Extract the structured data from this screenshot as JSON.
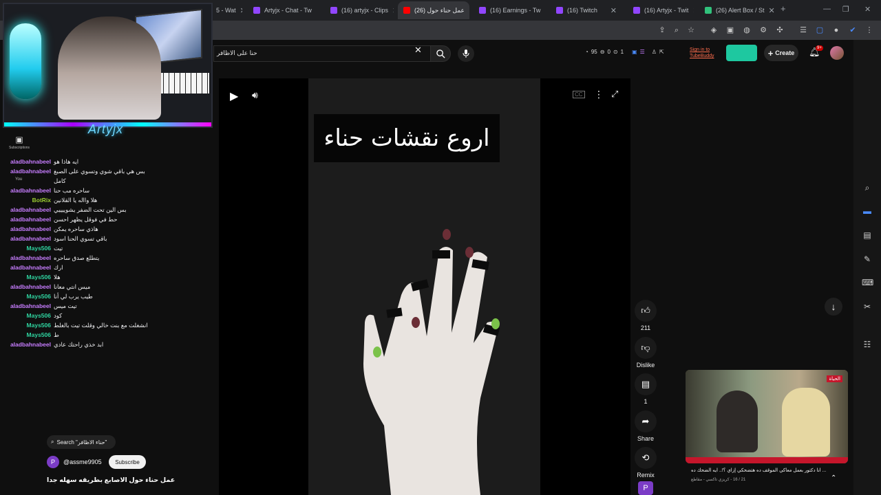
{
  "browser": {
    "tabs": [
      {
        "title": "5 - Wat",
        "favicon_color": "#9146ff"
      },
      {
        "title": "Artyjx - Chat - Tw",
        "favicon_color": "#9146ff"
      },
      {
        "title": "(16) artyjx - Clips",
        "favicon_color": "#9146ff"
      },
      {
        "title": "(26) عمل حناء حول",
        "favicon_color": "#ff0000",
        "active": true
      },
      {
        "title": "(16) Earnings - Tw",
        "favicon_color": "#9146ff"
      },
      {
        "title": "(16) Twitch",
        "favicon_color": "#9146ff"
      },
      {
        "title": "(16) Artyjx - Twit",
        "favicon_color": "#9146ff"
      },
      {
        "title": "(26) Alert Box / St",
        "favicon_color": "#31c27c"
      }
    ],
    "new_tab": "+",
    "window_controls": {
      "minimize": "—",
      "maximize": "❐",
      "close": "✕"
    }
  },
  "youtube": {
    "search_query": "حنا على الاظافر",
    "ext_stats": {
      "likes": "95",
      "dislikes": "0",
      "views": "1"
    },
    "tubebuddy": "Sign in to TubeBuddy",
    "create_label": "Create",
    "notif_badge": "9+"
  },
  "video": {
    "title_card": "اروع نقشات حناء"
  },
  "actions": {
    "like_count": "211",
    "dislike_label": "Dislike",
    "comment_count": "1",
    "share_label": "Share",
    "remix_label": "Remix"
  },
  "mini_player": {
    "logo": "الحياة",
    "caption": "... انا دكتور بعمل معاكي الموقف ده هتضحكي إزاي ؟!.. ايه الضحك ده",
    "sub": "21 / 16 - كريزي تاكسي - مقاطع"
  },
  "twitch": {
    "brand": "Artyjx",
    "subscriptions_label": "Subscriptions",
    "you_label": "You",
    "chat": [
      {
        "user": "aladbahnabeel",
        "color": "#c77dff",
        "text": "ايه هاذا هو"
      },
      {
        "user": "aladbahnabeel",
        "color": "#c77dff",
        "text": "بس هي باقي شوي وتسوي على الصبغ"
      },
      {
        "user": "",
        "color": "#c77dff",
        "text": "كامل"
      },
      {
        "user": "aladbahnabeel",
        "color": "#c77dff",
        "text": "ساحره مب حنا"
      },
      {
        "user": "BotRix",
        "color": "#9acd32",
        "text": "هلا وااله يا القلانين"
      },
      {
        "user": "aladbahnabeel",
        "color": "#c77dff",
        "text": "بس الين تحت الضفر يشوييييي"
      },
      {
        "user": "aladbahnabeel",
        "color": "#c77dff",
        "text": "حط في فوقل يظهر احسن"
      },
      {
        "user": "aladbahnabeel",
        "color": "#c77dff",
        "text": "هاذي ساحره يمكن"
      },
      {
        "user": "aladbahnabeel",
        "color": "#c77dff",
        "text": "باقي تسوي الحنا اسود"
      },
      {
        "user": "Mays506",
        "color": "#2fd4a0",
        "text": "تيت"
      },
      {
        "user": "aladbahnabeel",
        "color": "#c77dff",
        "text": "يتطلع صدق ساحره"
      },
      {
        "user": "aladbahnabeel",
        "color": "#c77dff",
        "text": "ارك"
      },
      {
        "user": "Mays506",
        "color": "#2fd4a0",
        "text": "هلا"
      },
      {
        "user": "aladbahnabeel",
        "color": "#c77dff",
        "text": "ميس انتي معانا"
      },
      {
        "user": "Mays506",
        "color": "#2fd4a0",
        "text": "طيب يرب لي أنا"
      },
      {
        "user": "aladbahnabeel",
        "color": "#c77dff",
        "text": "تيت ميس"
      },
      {
        "user": "Mays506",
        "color": "#2fd4a0",
        "text": "كود"
      },
      {
        "user": "Mays506",
        "color": "#2fd4a0",
        "text": "انشغلت مع بنت خالي وقلت تيت بالغلط"
      },
      {
        "user": "Mays506",
        "color": "#2fd4a0",
        "text": "ط"
      },
      {
        "user": "aladbahnabeel",
        "color": "#c77dff",
        "text": "ابد خذي راحتك عادي"
      }
    ]
  },
  "channel": {
    "search_chip": "Search \"حناء الاظافر\"",
    "avatar_letter": "P",
    "handle": "@assme9905",
    "subscribe_label": "Subscribe",
    "video_description": "عمل حناء حول الاصابع بطريقه سهله جدا"
  }
}
